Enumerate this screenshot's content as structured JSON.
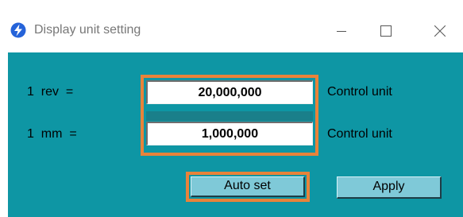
{
  "window": {
    "title": "Display unit setting",
    "app_icon": "lightning-bolt-icon",
    "controls": {
      "minimize_icon": "minimize-icon",
      "maximize_icon": "maximize-icon",
      "close_icon": "close-icon"
    }
  },
  "form": {
    "rows": [
      {
        "label": "1  rev  =",
        "value": "20,000,000",
        "unit": "Control unit"
      },
      {
        "label": "1  mm  =",
        "value": "1,000,000",
        "unit": "Control unit"
      }
    ]
  },
  "buttons": {
    "auto_set": "Auto set",
    "apply": "Apply"
  },
  "colors": {
    "client_background": "#0e96a4",
    "highlight": "#e8833a",
    "button_face": "#7fc9d8",
    "icon_blue": "#2563d9"
  }
}
